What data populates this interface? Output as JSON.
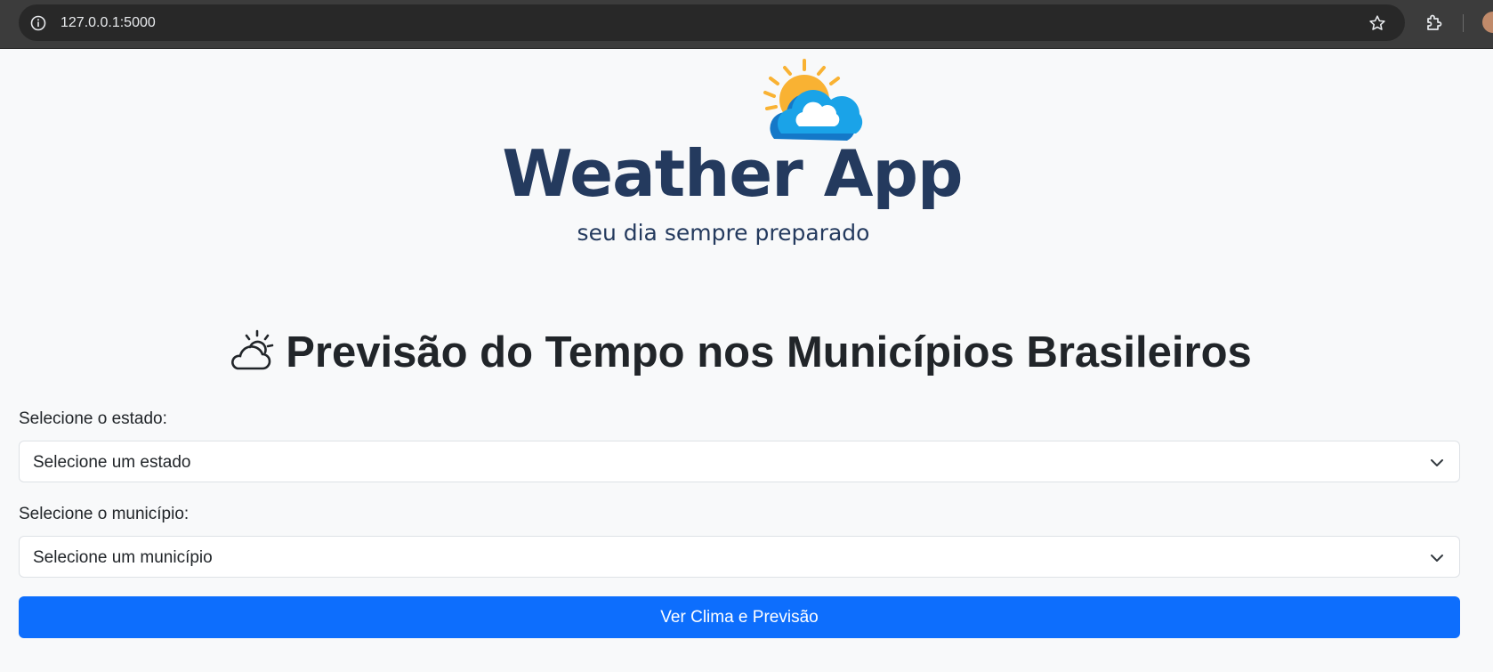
{
  "browser": {
    "url": "127.0.0.1:5000"
  },
  "logo": {
    "title": "Weather App",
    "tagline": "seu dia sempre preparado"
  },
  "heading": {
    "text": "Previsão do Tempo nos Municípios Brasileiros",
    "icon": "cloud-sun-icon"
  },
  "form": {
    "state_label": "Selecione o estado:",
    "state_value": "Selecione um estado",
    "city_label": "Selecione o município:",
    "city_value": "Selecione um município",
    "submit_label": "Ver Clima e Previsão"
  },
  "colors": {
    "primary": "#0d6efd",
    "logo_text": "#243a5e",
    "sun": "#f9b233",
    "cloud": "#1aa3e8"
  }
}
